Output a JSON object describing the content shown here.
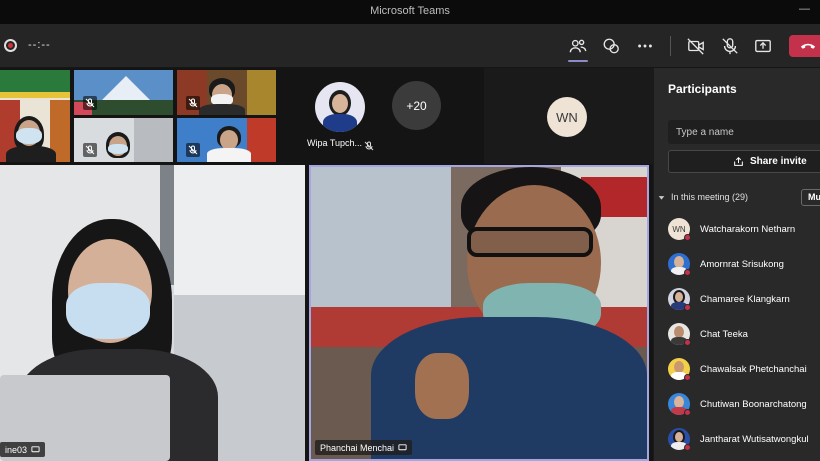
{
  "window": {
    "title": "Microsoft Teams",
    "minimize": "—"
  },
  "toolbar": {
    "timer": "--:--"
  },
  "stage": {
    "avatar_tile_name": "Wipa Tupch...",
    "more_count": "+20",
    "wn_initials": "WN",
    "left_video_name": "ine03",
    "right_video_name": "Phanchai Menchai"
  },
  "panel": {
    "title": "Participants",
    "search_placeholder": "Type a name",
    "share_label": "Share invite",
    "section_label": "In this meeting (29)",
    "mute_all_label": "Mu",
    "participants": [
      {
        "name": "Watcharakorn Netharn",
        "initials": "WN"
      },
      {
        "name": "Amornrat Srisukong"
      },
      {
        "name": "Chamaree Klangkarn"
      },
      {
        "name": "Chat Teeka"
      },
      {
        "name": "Chawalsak Phetchanchai"
      },
      {
        "name": "Chutiwan Boonarchatong"
      },
      {
        "name": "Jantharat Wutisatwongkul"
      }
    ]
  },
  "colors": {
    "accent": "#8b8cc7",
    "hangup": "#c4314b",
    "status_busy": "#c4314b"
  }
}
